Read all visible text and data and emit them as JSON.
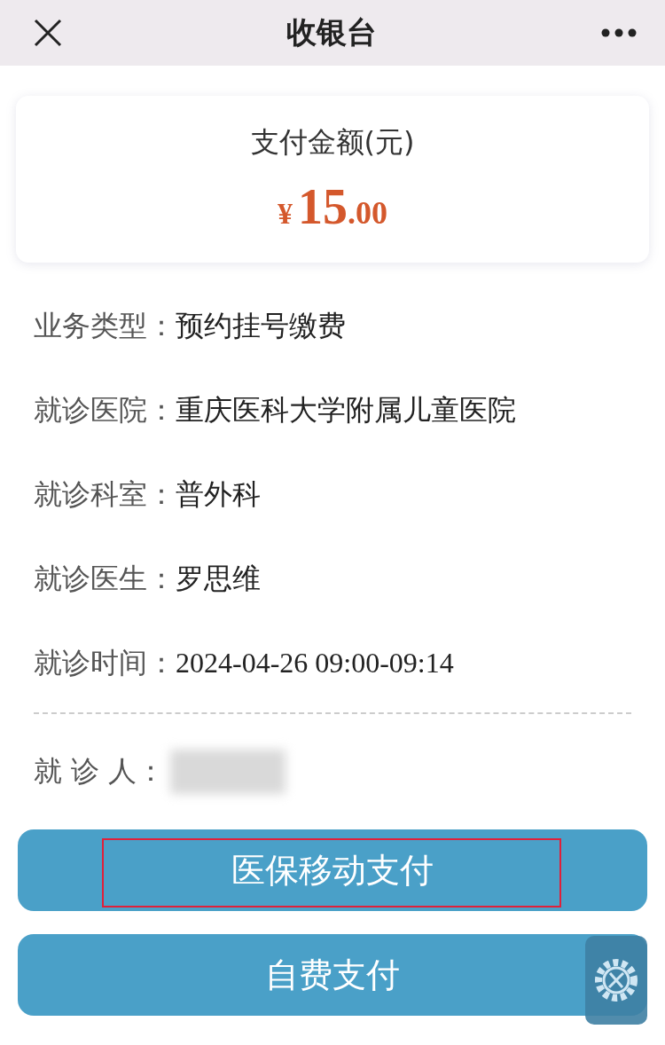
{
  "header": {
    "title": "收银台"
  },
  "amount_card": {
    "label": "支付金额(元)",
    "currency": "¥",
    "integer": "15",
    "decimals": ".00"
  },
  "details": [
    {
      "label": "业务类型：",
      "value": "预约挂号缴费"
    },
    {
      "label": "就诊医院：",
      "value": "重庆医科大学附属儿童医院"
    },
    {
      "label": "就诊科室：",
      "value": "普外科"
    },
    {
      "label": "就诊医生：",
      "value": "罗思维"
    },
    {
      "label": "就诊时间：",
      "value": "2024-04-26 09:00-09:14"
    }
  ],
  "patient": {
    "label": "就 诊 人：",
    "redacted": true
  },
  "buttons": [
    {
      "label": "医保移动支付",
      "highlighted": true
    },
    {
      "label": "自费支付",
      "highlighted": false
    }
  ]
}
